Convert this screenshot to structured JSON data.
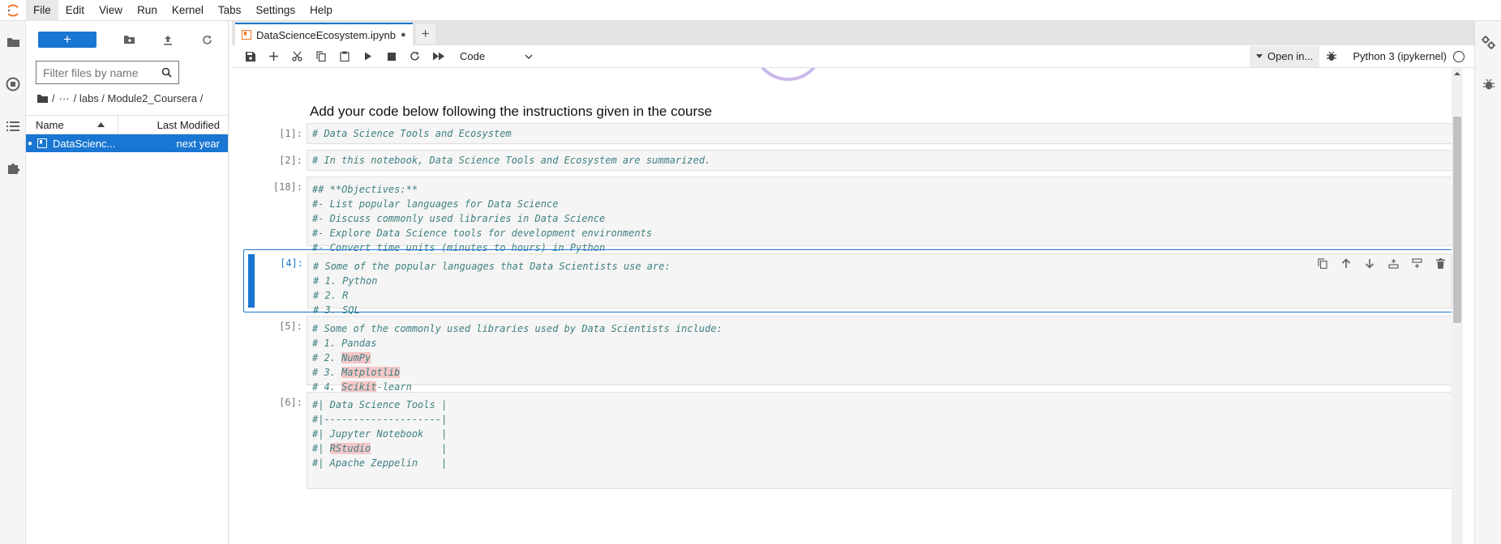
{
  "menu": [
    "File",
    "Edit",
    "View",
    "Run",
    "Kernel",
    "Tabs",
    "Settings",
    "Help"
  ],
  "filebrowser": {
    "new_label": "+",
    "filter_placeholder": "Filter files by name",
    "crumbs": {
      "sep1": "/",
      "ellipsis": "···",
      "path": "/ labs / Module2_Coursera /"
    },
    "col_name": "Name",
    "col_modified": "Last Modified",
    "file": {
      "name": "DataScienc...",
      "modified": "next year"
    }
  },
  "tab": {
    "title": "DataScienceEcosystem.ipynb",
    "add": "+"
  },
  "toolbar": {
    "cell_type": "Code",
    "open_in": "Open in...",
    "kernel": "Python 3 (ipykernel)"
  },
  "notebook": {
    "heading": "Add your code below following the instructions given in the course",
    "cells": {
      "c1": {
        "prompt": "[1]:",
        "l1": "# Data Science Tools and Ecosystem"
      },
      "c2": {
        "prompt": "[2]:",
        "l1": "# In this notebook, Data Science Tools and Ecosystem are summarized."
      },
      "c3": {
        "prompt": "[18]:",
        "l1": "## **Objectives:**",
        "l2": "#- List popular languages for Data Science",
        "l3": "#- Discuss commonly used libraries in Data Science",
        "l4": "#- Explore Data Science tools for development environments",
        "l5": "#- Convert time units (minutes to hours) in Python"
      },
      "c4": {
        "prompt": "[4]:",
        "l1": "# Some of the popular languages that Data Scientists use are:",
        "l2": "# 1. Python",
        "l3": "# 2. R",
        "l4": "# 3. SQL"
      },
      "c5": {
        "prompt": "[5]:",
        "l1": "# Some of the commonly used libraries used by Data Scientists include:",
        "l2": "# 1. Pandas",
        "l3a": "# 2. ",
        "l3b": "NumPy",
        "l4a": "# 3. ",
        "l4b": "Matplotlib",
        "l5a": "# 4. ",
        "l5b": "Scikit",
        "l5c": "-learn"
      },
      "c6": {
        "prompt": "[6]:",
        "l1": "#| Data Science Tools |",
        "l2": "#|--------------------|",
        "l3": "#| Jupyter Notebook   |",
        "l4a": "#| ",
        "l4b": "RStudio",
        "l4c": "            |",
        "l5": "#| Apache Zeppelin    |"
      }
    }
  },
  "colors": {
    "accent": "#1976d2",
    "comment": "#408080"
  }
}
